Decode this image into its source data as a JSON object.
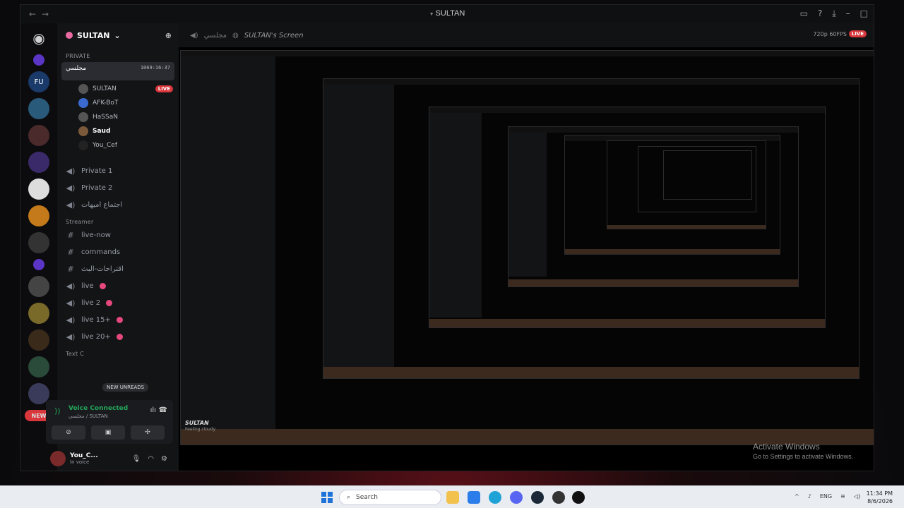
{
  "window": {
    "title": "SULTAN"
  },
  "guild": {
    "name": "SULTAN"
  },
  "categories": {
    "private": "PRIVATE",
    "streamer": "Streamer",
    "text": "Text C"
  },
  "voice_channel": {
    "name": "مجلسي",
    "timer": "1069:16:37"
  },
  "voice_users": [
    {
      "name": "SULTAN",
      "live": "LIVE"
    },
    {
      "name": "AFK-BoT"
    },
    {
      "name": "HaSSaN"
    },
    {
      "name": "Saud"
    },
    {
      "name": "You_Cef"
    }
  ],
  "channels": [
    {
      "name": "Private 1",
      "icon": "speaker-icon"
    },
    {
      "name": "Private 2",
      "icon": "speaker-icon"
    },
    {
      "name": "اجتماع اميهات",
      "icon": "speaker-icon"
    }
  ],
  "streamer_channels": [
    {
      "name": "live-now",
      "icon": "hash-icon"
    },
    {
      "name": "commands",
      "icon": "hash-icon"
    },
    {
      "name": "اقتراحات-البث",
      "icon": "hash-icon"
    },
    {
      "name": "live",
      "icon": "speaker-icon"
    },
    {
      "name": "live 2",
      "icon": "speaker-icon"
    },
    {
      "name": "live 15+",
      "icon": "speaker-icon"
    },
    {
      "name": "live 20+",
      "icon": "speaker-icon"
    }
  ],
  "new_unreads": "NEW UNREADS",
  "new_badge": "NEW",
  "voice_panel": {
    "title": "Voice Connected",
    "subtitle": "مجلسي / SULTAN"
  },
  "user": {
    "name": "You_C...",
    "status": "In voice"
  },
  "stream": {
    "title": "SULTAN's Screen",
    "channel": "مجلسي",
    "quality": "720p 60FPS",
    "live": "LIVE",
    "inner_user": "SULTAN",
    "inner_status": "Feeling cloudy"
  },
  "activate_windows": {
    "line1": "Activate Windows",
    "line2": "Go to Settings to activate Windows."
  },
  "taskbar": {
    "search": "Search",
    "lang": "ENG",
    "time": "11:34 PM",
    "date": "8/6/2026"
  },
  "colors": {
    "accent_live": "#da373c",
    "voice_green": "#23a55a",
    "blurple": "#5865f2"
  }
}
